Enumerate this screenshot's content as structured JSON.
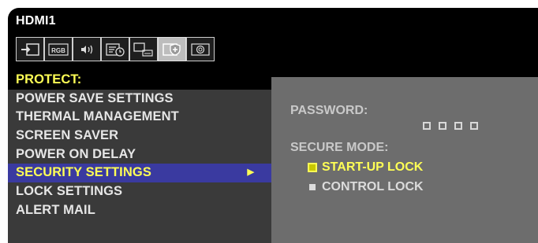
{
  "osd": {
    "source": "HDMI1",
    "icons": [
      {
        "name": "input-icon",
        "active": false
      },
      {
        "name": "rgb-picture-icon",
        "text": "RGB",
        "active": false
      },
      {
        "name": "audio-icon",
        "active": false
      },
      {
        "name": "schedule-icon",
        "active": false
      },
      {
        "name": "pc-settings-icon",
        "active": false
      },
      {
        "name": "protect-icon",
        "active": true
      },
      {
        "name": "system-icon",
        "active": false
      }
    ],
    "menu": {
      "header": "PROTECT:",
      "items": [
        {
          "label": "POWER SAVE SETTINGS"
        },
        {
          "label": "THERMAL MANAGEMENT"
        },
        {
          "label": "SCREEN SAVER"
        },
        {
          "label": "POWER ON DELAY"
        },
        {
          "label": "SECURITY SETTINGS",
          "selected": true,
          "arrow": "▶"
        },
        {
          "label": "LOCK SETTINGS"
        },
        {
          "label": "ALERT MAIL"
        }
      ]
    },
    "detail": {
      "password_label": "PASSWORD:",
      "password_slots": 4,
      "secure_mode_label": "SECURE MODE:",
      "options": [
        {
          "label": "START-UP LOCK",
          "selected": true
        },
        {
          "label": "CONTROL LOCK",
          "selected": false
        }
      ]
    },
    "colors": {
      "highlight_text": "#ffff55",
      "selected_row": "#3a3aa0",
      "panel_gray": "#6d6d6d"
    }
  }
}
